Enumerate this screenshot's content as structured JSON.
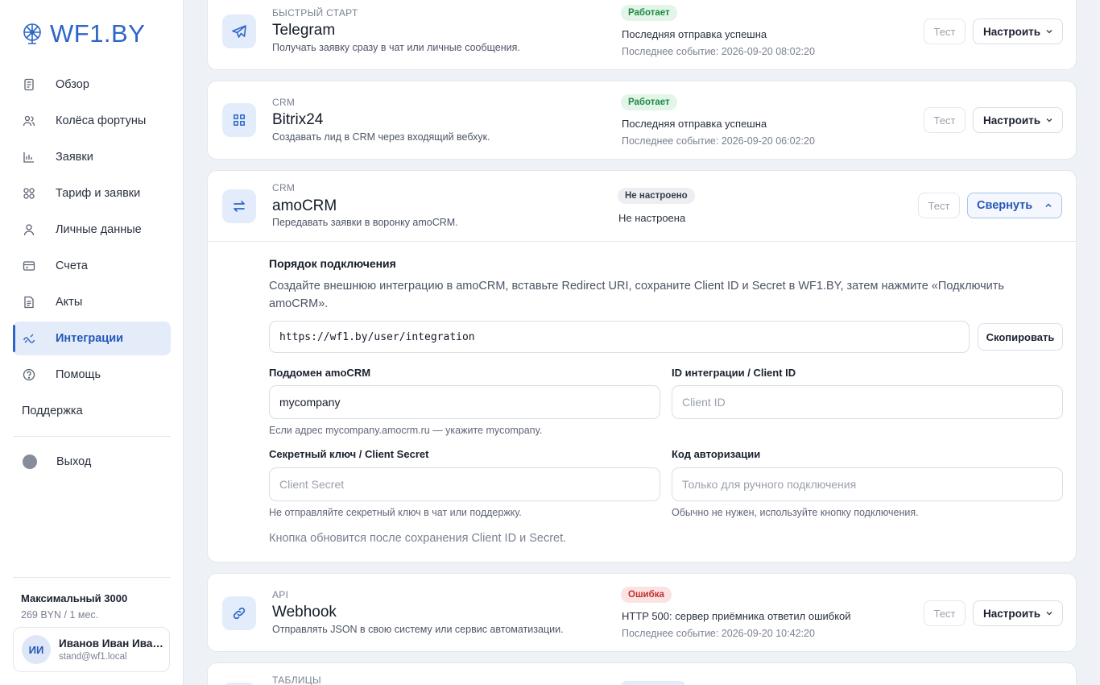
{
  "sidebar": {
    "logo": "WF1.BY",
    "items": [
      {
        "label": "Обзор"
      },
      {
        "label": "Колёса фортуны"
      },
      {
        "label": "Заявки"
      },
      {
        "label": "Тариф и заявки"
      },
      {
        "label": "Личные данные"
      },
      {
        "label": "Счета"
      },
      {
        "label": "Акты"
      },
      {
        "label": "Интеграции"
      },
      {
        "label": "Помощь"
      }
    ],
    "support": "Поддержка",
    "logout": "Выход",
    "plan": {
      "name": "Максимальный 3000",
      "price": "269 BYN / 1 мес."
    },
    "user": {
      "initials": "ИИ",
      "name": "Иванов Иван Ива…",
      "email": "stand@wf1.local"
    }
  },
  "integrations": [
    {
      "category": "БЫСТРЫЙ СТАРТ",
      "title": "Telegram",
      "description": "Получать заявку сразу в чат или личные сообщения.",
      "badge": "Работает",
      "status": "Последняя отправка успешна",
      "event": "Последнее событие: 2026-09-20 08:02:20",
      "test_label": "Тест",
      "config_label": "Настроить"
    },
    {
      "category": "CRM",
      "title": "Bitrix24",
      "description": "Создавать лид в CRM через входящий вебхук.",
      "badge": "Работает",
      "status": "Последняя отправка успешна",
      "event": "Последнее событие: 2026-09-20 06:02:20",
      "test_label": "Тест",
      "config_label": "Настроить"
    },
    {
      "category": "CRM",
      "title": "amoCRM",
      "description": "Передавать заявки в воронку amoCRM.",
      "badge": "Не настроено",
      "status": "Не настроена",
      "test_label": "Тест",
      "collapse_label": "Свернуть",
      "panel": {
        "title": "Порядок подключения",
        "text": "Создайте внешнюю интеграцию в amoCRM, вставьте Redirect URI, сохраните Client ID и Secret в WF1.BY, затем нажмите «Подключить amoCRM».",
        "redirect_uri": "https://wf1.by/user/integration",
        "copy_label": "Скопировать",
        "subdomain_label": "Поддомен amoCRM",
        "subdomain_value": "mycompany",
        "subdomain_hint": "Если адрес mycompany.amocrm.ru — укажите mycompany.",
        "client_id_label": "ID интеграции / Client ID",
        "client_id_placeholder": "Client ID",
        "secret_label": "Секретный ключ / Client Secret",
        "secret_placeholder": "Client Secret",
        "secret_hint": "Не отправляйте секретный ключ в чат или поддержку.",
        "auth_code_label": "Код авторизации",
        "auth_code_placeholder": "Только для ручного подключения",
        "auth_code_hint": "Обычно не нужен, используйте кнопку подключения.",
        "footer": "Кнопка обновится после сохранения Client ID и Secret."
      }
    },
    {
      "category": "API",
      "title": "Webhook",
      "description": "Отправлять JSON в свою систему или сервис автоматизации.",
      "badge": "Ошибка",
      "status": "HTTP 500: сервер приёмника ответил ошибкой",
      "event": "Последнее событие: 2026-09-20 10:42:20",
      "test_label": "Тест",
      "config_label": "Настроить"
    },
    {
      "category": "ТАБЛИЦЫ"
    }
  ]
}
